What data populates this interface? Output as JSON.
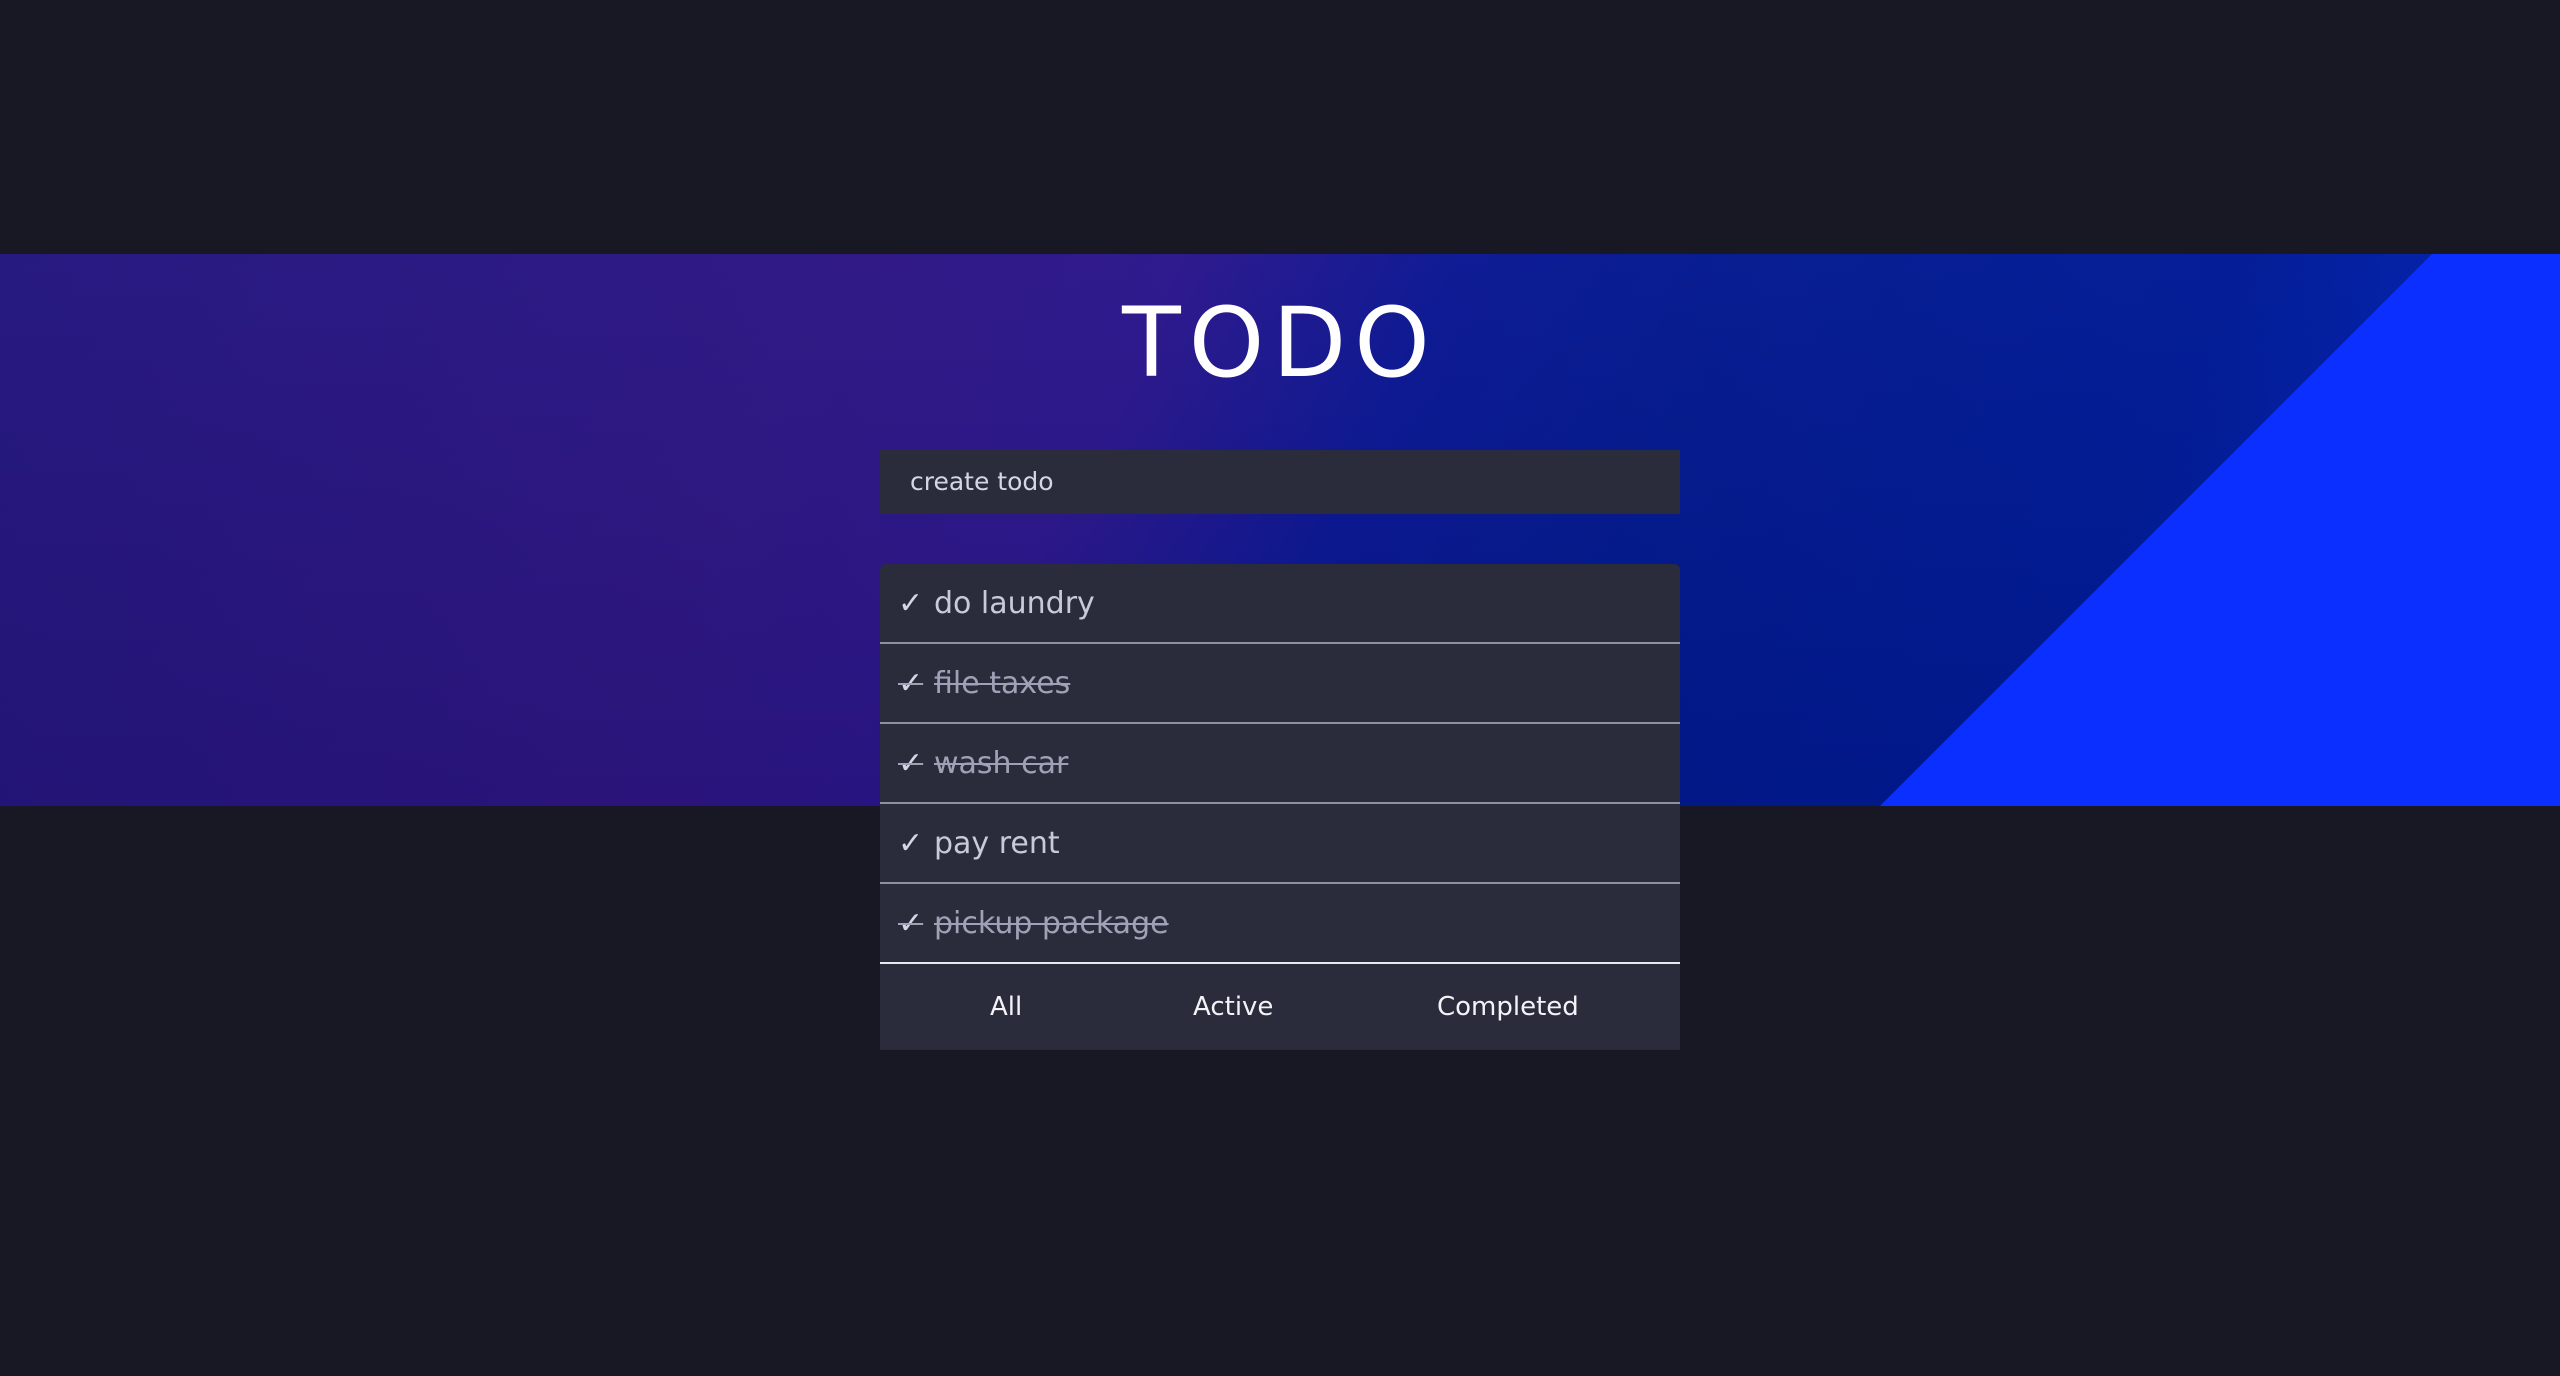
{
  "app": {
    "title": "TODO"
  },
  "create": {
    "placeholder": "create todo"
  },
  "todos": [
    {
      "text": "do laundry",
      "completed": false
    },
    {
      "text": "file taxes",
      "completed": true
    },
    {
      "text": "wash car",
      "completed": true
    },
    {
      "text": "pay rent",
      "completed": false
    },
    {
      "text": "pickup package",
      "completed": true
    }
  ],
  "check_glyph": "✓",
  "filters": {
    "all": "All",
    "active": "Active",
    "completed": "Completed"
  },
  "colors": {
    "page_background": "#181824",
    "panel_background": "#2b2c3b",
    "stripe_accent": "#0a2fff"
  }
}
